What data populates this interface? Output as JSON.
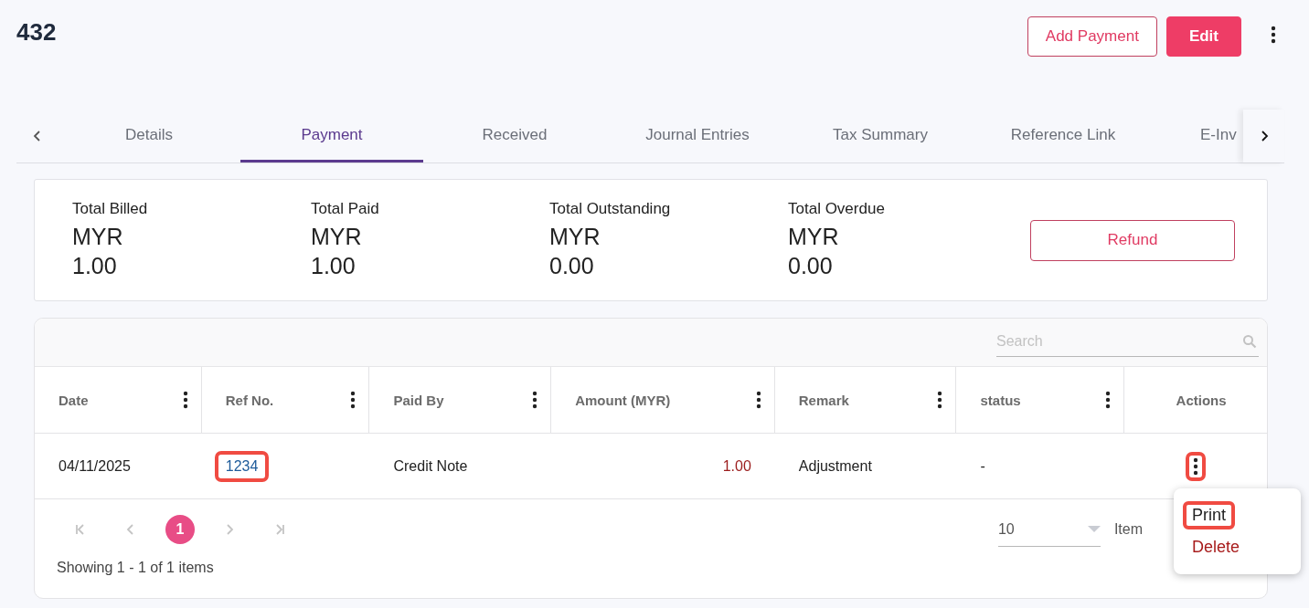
{
  "title": "432",
  "header_buttons": [
    {
      "label": "Add Payment",
      "kind": "outline"
    },
    {
      "label": "Edit",
      "kind": "solid"
    }
  ],
  "tabs": [
    {
      "label": "Details",
      "selected": false
    },
    {
      "label": "Payment",
      "selected": true
    },
    {
      "label": "Received",
      "selected": false
    },
    {
      "label": "Journal Entries",
      "selected": false
    },
    {
      "label": "Tax Summary",
      "selected": false
    },
    {
      "label": "Reference Link",
      "selected": false
    },
    {
      "label": "E-Inv",
      "selected": false
    }
  ],
  "summary": [
    {
      "label": "Total Billed",
      "currency": "MYR",
      "amount": "1.00"
    },
    {
      "label": "Total Paid",
      "currency": "MYR",
      "amount": "1.00"
    },
    {
      "label": "Total Outstanding",
      "currency": "MYR",
      "amount": "0.00"
    },
    {
      "label": "Total Overdue",
      "currency": "MYR",
      "amount": "0.00"
    }
  ],
  "refund_button": "Refund",
  "search": {
    "placeholder": "Search"
  },
  "table": {
    "columns": [
      {
        "label": "Date",
        "menu": true
      },
      {
        "label": "Ref No.",
        "menu": true
      },
      {
        "label": "Paid By",
        "menu": true
      },
      {
        "label": "Amount (MYR)",
        "menu": true
      },
      {
        "label": "Remark",
        "menu": true
      },
      {
        "label": "status",
        "menu": true
      },
      {
        "label": "Actions",
        "menu": false
      }
    ],
    "rows": [
      {
        "date": "04/11/2025",
        "ref_no": {
          "text": "1234",
          "highlighted": true
        },
        "paid_by": "Credit Note",
        "amount": "1.00",
        "remark": "Adjustment",
        "status": "-",
        "actions_highlighted": true
      }
    ]
  },
  "pager": {
    "pages": [
      {
        "label": "1",
        "selected": true
      }
    ],
    "page_size": "10",
    "page_size_label": "Item",
    "summary": "Showing 1 - 1 of 1 items"
  },
  "action_menu": [
    {
      "label": "Print",
      "kind": "normal",
      "highlighted": true
    },
    {
      "label": "Delete",
      "kind": "danger",
      "highlighted": false
    }
  ]
}
